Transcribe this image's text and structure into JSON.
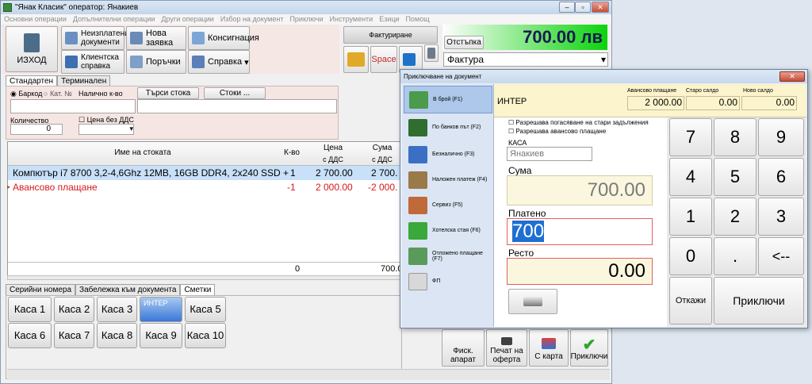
{
  "window": {
    "title": "\"Янак Класик\" оператор: Янакиев"
  },
  "menu": [
    "Основни операции",
    "Допълнителни операции",
    "Други операции",
    "Избор на документ",
    "Приключи",
    "Инструменти",
    "Езици",
    "Помощ"
  ],
  "toolbar": {
    "exit": "ИЗХОД",
    "unpaid": "Неизплатени документи",
    "new_request": "Нова заявка",
    "consignment": "Консигнация",
    "client_ref": "Клиентска справка",
    "orders": "Поръчки",
    "report": "Справка",
    "invoicing": "Фактуриране",
    "discount": "Отстъпка",
    "space": "Space",
    "doc_type": "Фактура",
    "total": "700.00 лв"
  },
  "tabs": {
    "standard": "Стандартен",
    "terminal": "Терминален"
  },
  "search": {
    "barcode": "Баркод",
    "cat_no": "Кат. №",
    "available": "Налично к-во",
    "find_btn": "Търси стока",
    "goods_btn": "Стоки ...",
    "qty_label": "Количество",
    "qty_value": "0",
    "no_vat": "Цена без ДДС"
  },
  "grid": {
    "col_name": "Име на стоката",
    "col_qty": "К-во",
    "col_price": "Цена",
    "col_price_sub": "с ДДС",
    "col_sum": "Сума",
    "col_sum_sub": "с ДДС",
    "rows": [
      {
        "name": "Компютър i7 8700 3,2-4,6Ghz 12MB, 16GB DDR4, 2x240 SSD +",
        "qty": "1",
        "price": "2 700.00",
        "sum": "2 700."
      },
      {
        "name": "Авансово плащане",
        "qty": "-1",
        "price": "2 000.00",
        "sum": "-2 000."
      }
    ],
    "footer_qty": "0",
    "footer_sum": "700.0"
  },
  "bottom_tabs": [
    "Серийни номера",
    "Забележка към документа",
    "Сметки"
  ],
  "cash": [
    "Каса 1",
    "Каса 2",
    "Каса 3",
    "ИНТЕР",
    "Каса 5",
    "Каса 6",
    "Каса 7",
    "Каса 8",
    "Каса 9",
    "Каса 10"
  ],
  "bottom_actions": {
    "fiscal": "Фиск. апарат",
    "print_offer": "Печат на оферта",
    "card": "С карта",
    "finish": "Приключи"
  },
  "dialog": {
    "title": "Приключване на документ",
    "client": "ИНТЕР",
    "adv_label": "Авансово плащане",
    "old_label": "Старо салдо",
    "new_label": "Ново салдо",
    "adv": "2 000.00",
    "old": "0.00",
    "new": "0.00",
    "methods": [
      "В брой (F1)",
      "По банков път (F2)",
      "Безналично (F3)",
      "Наложен платеж (F4)",
      "Сервиз (F5)",
      "Хотелска стая (F6)",
      "Отложено плащане (F7)",
      "ФП"
    ],
    "chk_old": "Разрешава погасяване на стари задължения",
    "chk_adv": "Разрешава авансово плащане",
    "kasa_label": "КАСА",
    "kasa_value": "Янакиев",
    "sum_label": "Сума",
    "sum_value": "700.00",
    "paid_label": "Платено",
    "paid_value": "700",
    "change_label": "Ресто",
    "change_value": "0.00",
    "keys": [
      "7",
      "8",
      "9",
      "4",
      "5",
      "6",
      "1",
      "2",
      "3",
      "0",
      ".",
      "<--"
    ],
    "cancel": "Откажи",
    "finish": "Приключи"
  }
}
